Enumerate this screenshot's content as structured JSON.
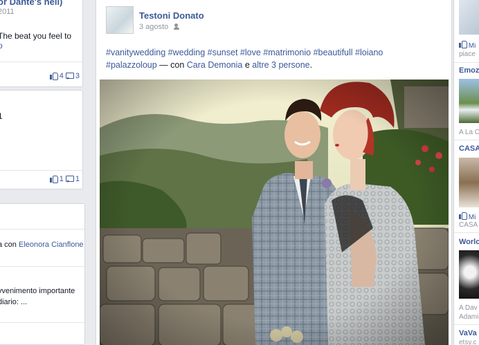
{
  "left_column": {
    "card1": {
      "title": "or Dante's hell)",
      "date": "2011",
      "text": "The beat you feel to",
      "link": "o",
      "likes": "4",
      "comments": "3"
    },
    "card2": {
      "line1": "1",
      "line2": ",",
      "likes": "1",
      "comments": "1"
    },
    "card3": {
      "shared_with_prefix": "a con",
      "shared_with_name": "Eleonora Cianflone",
      "text1": "vvenimento importante",
      "text2": "diario: ..."
    }
  },
  "post": {
    "author": "Testoni Donato",
    "date": "3 agosto",
    "audience_icon": "friends-icon",
    "hashtags_line1": [
      "#vanitywedding",
      "#wedding",
      "#sunset",
      "#love",
      "#matrimonio",
      "#beautifull",
      "#loiano"
    ],
    "hashtags_line2_tag": "#palazzoloup",
    "with_text": " — con ",
    "tagged_person": "Cara Demonia",
    "and_text": " e ",
    "others_text": "altre 3 persone",
    "end_punct": "."
  },
  "right_column": {
    "item1_label": "Mi",
    "item1_sub": "piace",
    "head1": "Emoz",
    "sub1": "A La C",
    "head2": "CASA",
    "item2_label": "Mi",
    "item2_sub": "CASA",
    "head3": "Worlc",
    "sub3a": "A Dav",
    "sub3b": "Adami",
    "head4": "VaVa",
    "sub4": "etsy.c"
  }
}
